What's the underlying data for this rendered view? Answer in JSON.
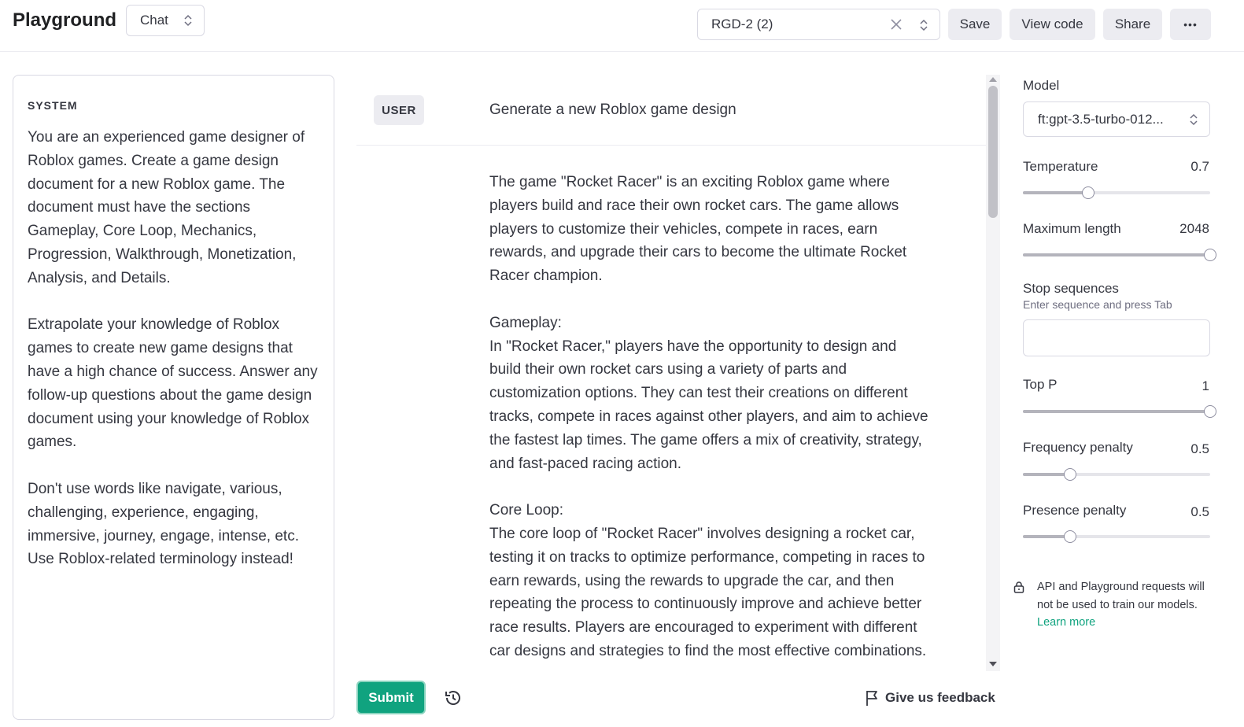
{
  "header": {
    "title": "Playground",
    "mode": "Chat",
    "preset": "RGD-2 (2)",
    "save_label": "Save",
    "view_code_label": "View code",
    "share_label": "Share",
    "more_label": "•••"
  },
  "system": {
    "label": "SYSTEM",
    "text": "You are an experienced game designer of Roblox games. Create a game design document for a new Roblox game. The document must have the sections Gameplay, Core Loop, Mechanics, Progression, Walkthrough, Monetization, Analysis, and Details.\n\nExtrapolate your knowledge of Roblox games to create new game designs that have a high chance of success. Answer any follow-up questions about the game design document using your knowledge of Roblox games.\n\nDon't use words like navigate, various, challenging, experience, engaging, immersive, journey, engage, intense, etc. Use Roblox-related terminology instead!"
  },
  "conversation": {
    "user_role": "USER",
    "user_message": "Generate a new Roblox game design",
    "assistant_message": "The game \"Rocket Racer\" is an exciting Roblox game where players build and race their own rocket cars. The game allows players to customize their vehicles, compete in races, earn rewards, and upgrade their cars to become the ultimate Rocket Racer champion.\n\nGameplay:\nIn \"Rocket Racer,\" players have the opportunity to design and build their own rocket cars using a variety of parts and customization options. They can test their creations on different tracks, compete in races against other players, and aim to achieve the fastest lap times. The game offers a mix of creativity, strategy, and fast-paced racing action.\n\nCore Loop:\nThe core loop of \"Rocket Racer\" involves designing a rocket car, testing it on tracks to optimize performance, competing in races to earn rewards, using the rewards to upgrade the car, and then repeating the process to continuously improve and achieve better race results. Players are encouraged to experiment with different car designs and strategies to find the most effective combinations."
  },
  "footer": {
    "submit_label": "Submit",
    "feedback_label": "Give us feedback"
  },
  "settings": {
    "model_label": "Model",
    "model_value": "ft:gpt-3.5-turbo-012...",
    "temperature": {
      "label": "Temperature",
      "value": "0.7",
      "fraction": 0.35
    },
    "max_length": {
      "label": "Maximum length",
      "value": "2048",
      "fraction": 1.0
    },
    "stop_sequences": {
      "label": "Stop sequences",
      "hint": "Enter sequence and press Tab"
    },
    "top_p": {
      "label": "Top P",
      "value": "1",
      "fraction": 1.0
    },
    "frequency_penalty": {
      "label": "Frequency penalty",
      "value": "0.5",
      "fraction": 0.25
    },
    "presence_penalty": {
      "label": "Presence penalty",
      "value": "0.5",
      "fraction": 0.25
    },
    "notice_text": "API and Playground requests will not be used to train our models. ",
    "learn_more": "Learn more"
  },
  "colors": {
    "accent": "#10a37f",
    "border": "#d9d9e3",
    "button_bg": "#ececf1",
    "text": "#353740"
  },
  "icons": [
    "chevron-up-down-icon",
    "clear-x-icon",
    "more-icon",
    "history-icon",
    "flag-icon",
    "lock-icon"
  ]
}
